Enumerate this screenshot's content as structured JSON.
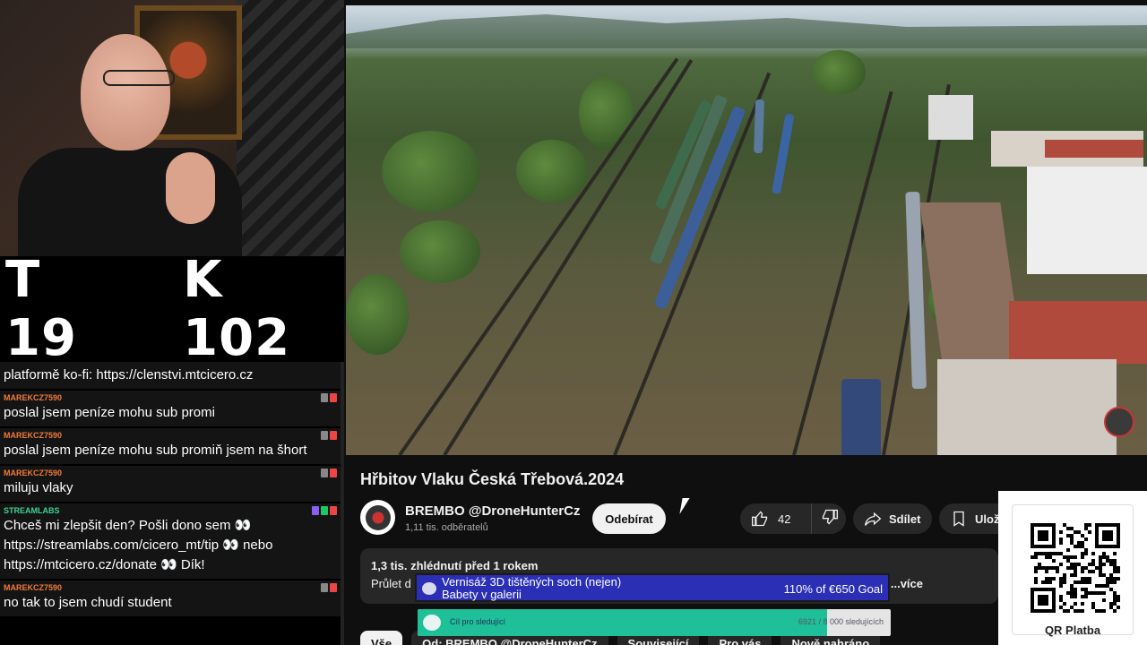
{
  "stream": {
    "counter_t": "T 19",
    "counter_k": "K 102"
  },
  "chat": {
    "messages": [
      {
        "user": "",
        "text": "platformě ko-fi: https://clenstvi.mtcicero.cz"
      },
      {
        "user": "MAREKCZ7590",
        "text": "poslal jsem peníze mohu sub promi"
      },
      {
        "user": "MAREKCZ7590",
        "text": "poslal jsem peníze mohu sub promiň jsem na šhort"
      },
      {
        "user": "MAREKCZ7590",
        "text": "miluju vlaky"
      },
      {
        "user": "STREAMLABS",
        "text1": "Chceš mi zlepšit den? Pošli dono sem 👀",
        "text2": "https://streamlabs.com/cicero_mt/tip 👀 nebo",
        "text3": "https://mtcicero.cz/donate 👀 Dík!"
      },
      {
        "user": "MAREKCZ7590",
        "text": "no tak to jsem chudí student"
      }
    ]
  },
  "video": {
    "title": "Hřbitov Vlaku Česká Třebová.2024",
    "channel_name": "BREMBO @DroneHunterCz",
    "subscribers": "1,11 tis. odběratelů",
    "subscribe_label": "Odebírat",
    "likes": "42",
    "share_label": "Sdílet",
    "save_label": "Ulož",
    "views_line": "1,3 tis. zhlédnutí  před 1 rokem",
    "desc_line": "Průlet d",
    "more_label": "...více"
  },
  "chips": [
    "Vše",
    "Od: BREMBO @DroneHunterCz",
    "Související",
    "Pro vás",
    "Nově nahráno"
  ],
  "overlays": {
    "goal1_line1": "Vernisáž 3D tištěných soch (nejen)",
    "goal1_line2": "Babety v galerii",
    "goal1_amount": "110% of €650 Goal",
    "goal2_label": "Cíl pro sledující",
    "goal2_count": "6921 / 8 000 sledujících",
    "goal2_progress": 0.865,
    "qr_label": "QR Platba"
  }
}
